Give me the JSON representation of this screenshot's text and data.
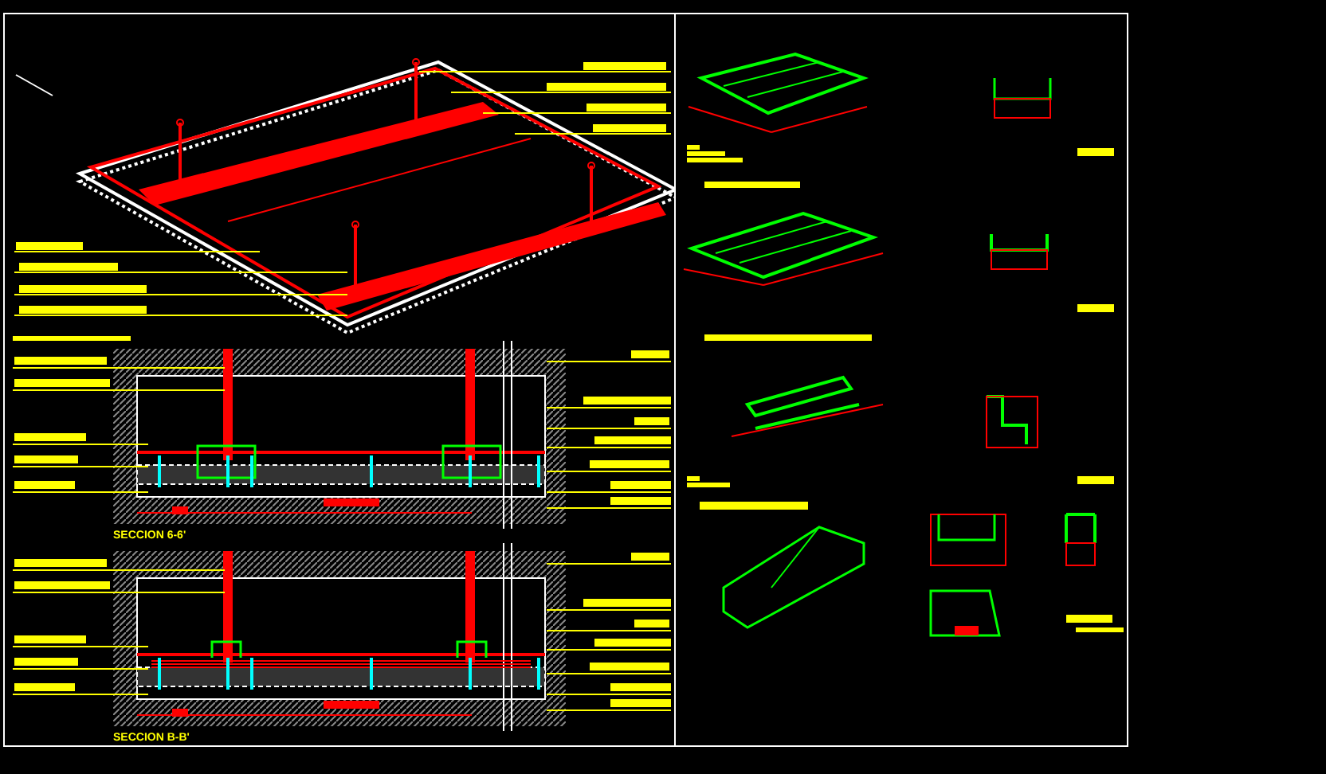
{
  "drawing": {
    "sections": [
      {
        "label": "SECCION 6-6'"
      },
      {
        "label": "SECCION B-B'"
      }
    ]
  }
}
